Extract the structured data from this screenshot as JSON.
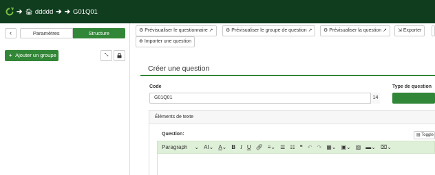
{
  "breadcrumb": {
    "survey": "ddddd",
    "question": "G01Q01"
  },
  "sidebar": {
    "tabs": [
      {
        "label": "Paramètres"
      },
      {
        "label": "Structure"
      }
    ],
    "add_group_label": "Ajouter un groupe",
    "add_group_icon": "+"
  },
  "toolbar": {
    "buttons": [
      {
        "label": "Prévisualiser le questionnaire"
      },
      {
        "label": "Prévisualiser le groupe de question"
      },
      {
        "label": "Prévisualiser la question"
      },
      {
        "label": "Exporter"
      }
    ],
    "import_label": "Importer une question"
  },
  "panel": {
    "title": "Créer une question",
    "code_label": "Code",
    "code_value": "G01Q01",
    "code_counter": "14",
    "type_label": "Type de question"
  },
  "editor": {
    "section_title": "Éléments de texte",
    "question_label": "Question:",
    "toggle_label": "Toggle",
    "format_select": "Paragraph"
  },
  "colors": {
    "topbar": "#0f3d1e",
    "accent": "#328637",
    "editor_toolbar": "#dff0d8"
  }
}
